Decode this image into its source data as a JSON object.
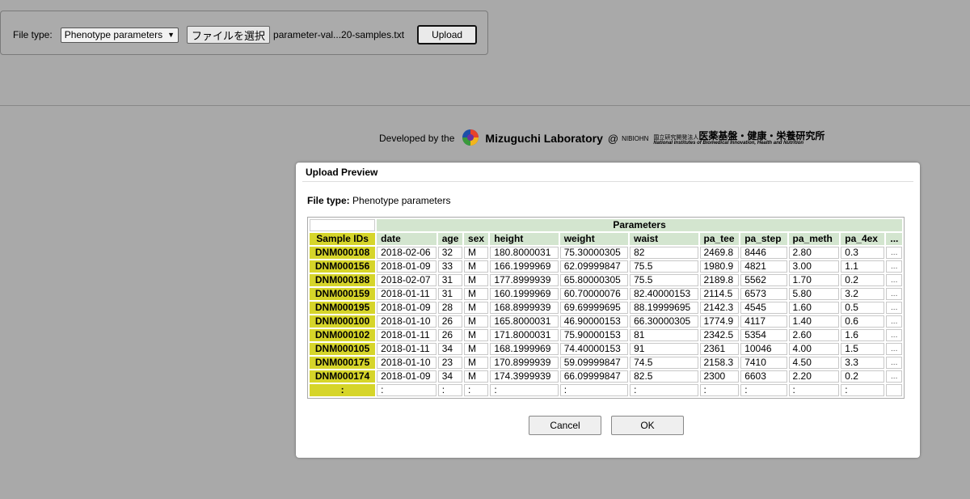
{
  "upload": {
    "file_type_label": "File type:",
    "file_type_selected": "Phenotype parameters",
    "choose_file_label": "ファイルを選択",
    "file_name": "parameter-val...20-samples.txt",
    "upload_label": "Upload"
  },
  "credit": {
    "developed_by": "Developed by the",
    "lab_name": "Mizuguchi Laboratory",
    "at": "@",
    "nibiohn": "NIBIOHN",
    "inst_prefix": "国立研究開発法人",
    "inst_name": "医薬基盤・健康・栄養研究所",
    "inst_en": "National Institutes of Biomedical Innovation, Health and Nutrition"
  },
  "dialog": {
    "title": "Upload Preview",
    "file_type_label": "File type:",
    "file_type_value": "Phenotype parameters",
    "params_header": "Parameters",
    "columns": [
      "Sample IDs",
      "date",
      "age",
      "sex",
      "height",
      "weight",
      "waist",
      "pa_tee",
      "pa_step",
      "pa_meth",
      "pa_4ex",
      "..."
    ],
    "rows": [
      [
        "DNM000108",
        "2018-02-06",
        "32",
        "M",
        "180.8000031",
        "75.30000305",
        "82",
        "2469.8",
        "8446",
        "2.80",
        "0.3",
        "..."
      ],
      [
        "DNM000156",
        "2018-01-09",
        "33",
        "M",
        "166.1999969",
        "62.09999847",
        "75.5",
        "1980.9",
        "4821",
        "3.00",
        "1.1",
        "..."
      ],
      [
        "DNM000188",
        "2018-02-07",
        "31",
        "M",
        "177.8999939",
        "65.80000305",
        "75.5",
        "2189.8",
        "5562",
        "1.70",
        "0.2",
        "..."
      ],
      [
        "DNM000159",
        "2018-01-11",
        "31",
        "M",
        "160.1999969",
        "60.70000076",
        "82.40000153",
        "2114.5",
        "6573",
        "5.80",
        "3.2",
        "..."
      ],
      [
        "DNM000195",
        "2018-01-09",
        "28",
        "M",
        "168.8999939",
        "69.69999695",
        "88.19999695",
        "2142.3",
        "4545",
        "1.60",
        "0.5",
        "..."
      ],
      [
        "DNM000100",
        "2018-01-10",
        "26",
        "M",
        "165.8000031",
        "46.90000153",
        "66.30000305",
        "1774.9",
        "4117",
        "1.40",
        "0.6",
        "..."
      ],
      [
        "DNM000102",
        "2018-01-11",
        "26",
        "M",
        "171.8000031",
        "75.90000153",
        "81",
        "2342.5",
        "5354",
        "2.60",
        "1.6",
        "..."
      ],
      [
        "DNM000105",
        "2018-01-11",
        "34",
        "M",
        "168.1999969",
        "74.40000153",
        "91",
        "2361",
        "10046",
        "4.00",
        "1.5",
        "..."
      ],
      [
        "DNM000175",
        "2018-01-10",
        "23",
        "M",
        "170.8999939",
        "59.09999847",
        "74.5",
        "2158.3",
        "7410",
        "4.50",
        "3.3",
        "..."
      ],
      [
        "DNM000174",
        "2018-01-09",
        "34",
        "M",
        "174.3999939",
        "66.09999847",
        "82.5",
        "2300",
        "6603",
        "2.20",
        "0.2",
        "..."
      ],
      [
        ":",
        ":",
        ":",
        ":",
        ":",
        ":",
        ":",
        ":",
        ":",
        ":",
        ":",
        ""
      ]
    ],
    "cancel_label": "Cancel",
    "ok_label": "OK"
  }
}
